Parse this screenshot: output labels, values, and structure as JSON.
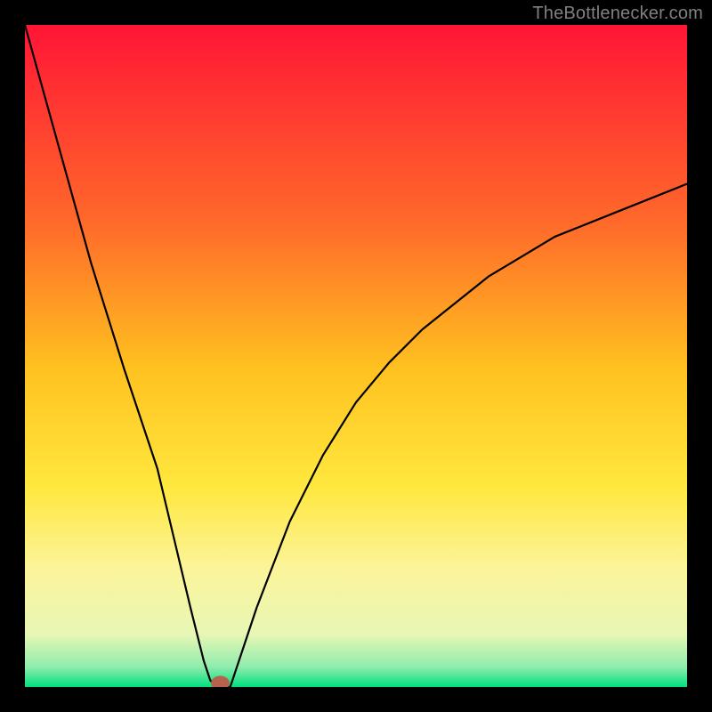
{
  "watermark": "TheBottlenecker.com",
  "chart_data": {
    "type": "line",
    "title": "",
    "xlabel": "",
    "ylabel": "",
    "xlim": [
      0,
      100
    ],
    "ylim": [
      0,
      100
    ],
    "series": [
      {
        "name": "bottleneck-curve",
        "x": [
          0,
          5,
          10,
          15,
          20,
          25,
          27,
          28,
          29,
          30,
          31,
          32,
          35,
          40,
          45,
          50,
          55,
          60,
          65,
          70,
          75,
          80,
          85,
          90,
          95,
          100
        ],
        "values": [
          100,
          82,
          64,
          48,
          33,
          12,
          4,
          1,
          0,
          0,
          0,
          3,
          12,
          25,
          35,
          43,
          49,
          54,
          58,
          62,
          65,
          68,
          70,
          72,
          74,
          76
        ]
      }
    ],
    "marker": {
      "x": 29.5,
      "y": 0,
      "color": "#b5624e"
    },
    "gradient_stops": [
      {
        "offset": 0.0,
        "color": "#ff1536"
      },
      {
        "offset": 0.3,
        "color": "#ff6a2a"
      },
      {
        "offset": 0.52,
        "color": "#ffc21f"
      },
      {
        "offset": 0.7,
        "color": "#ffe83f"
      },
      {
        "offset": 0.82,
        "color": "#fcf49a"
      },
      {
        "offset": 0.92,
        "color": "#e8f7b4"
      },
      {
        "offset": 0.97,
        "color": "#8eecad"
      },
      {
        "offset": 1.0,
        "color": "#00e07e"
      }
    ],
    "line_color": "#000000",
    "line_width": 2.2
  }
}
